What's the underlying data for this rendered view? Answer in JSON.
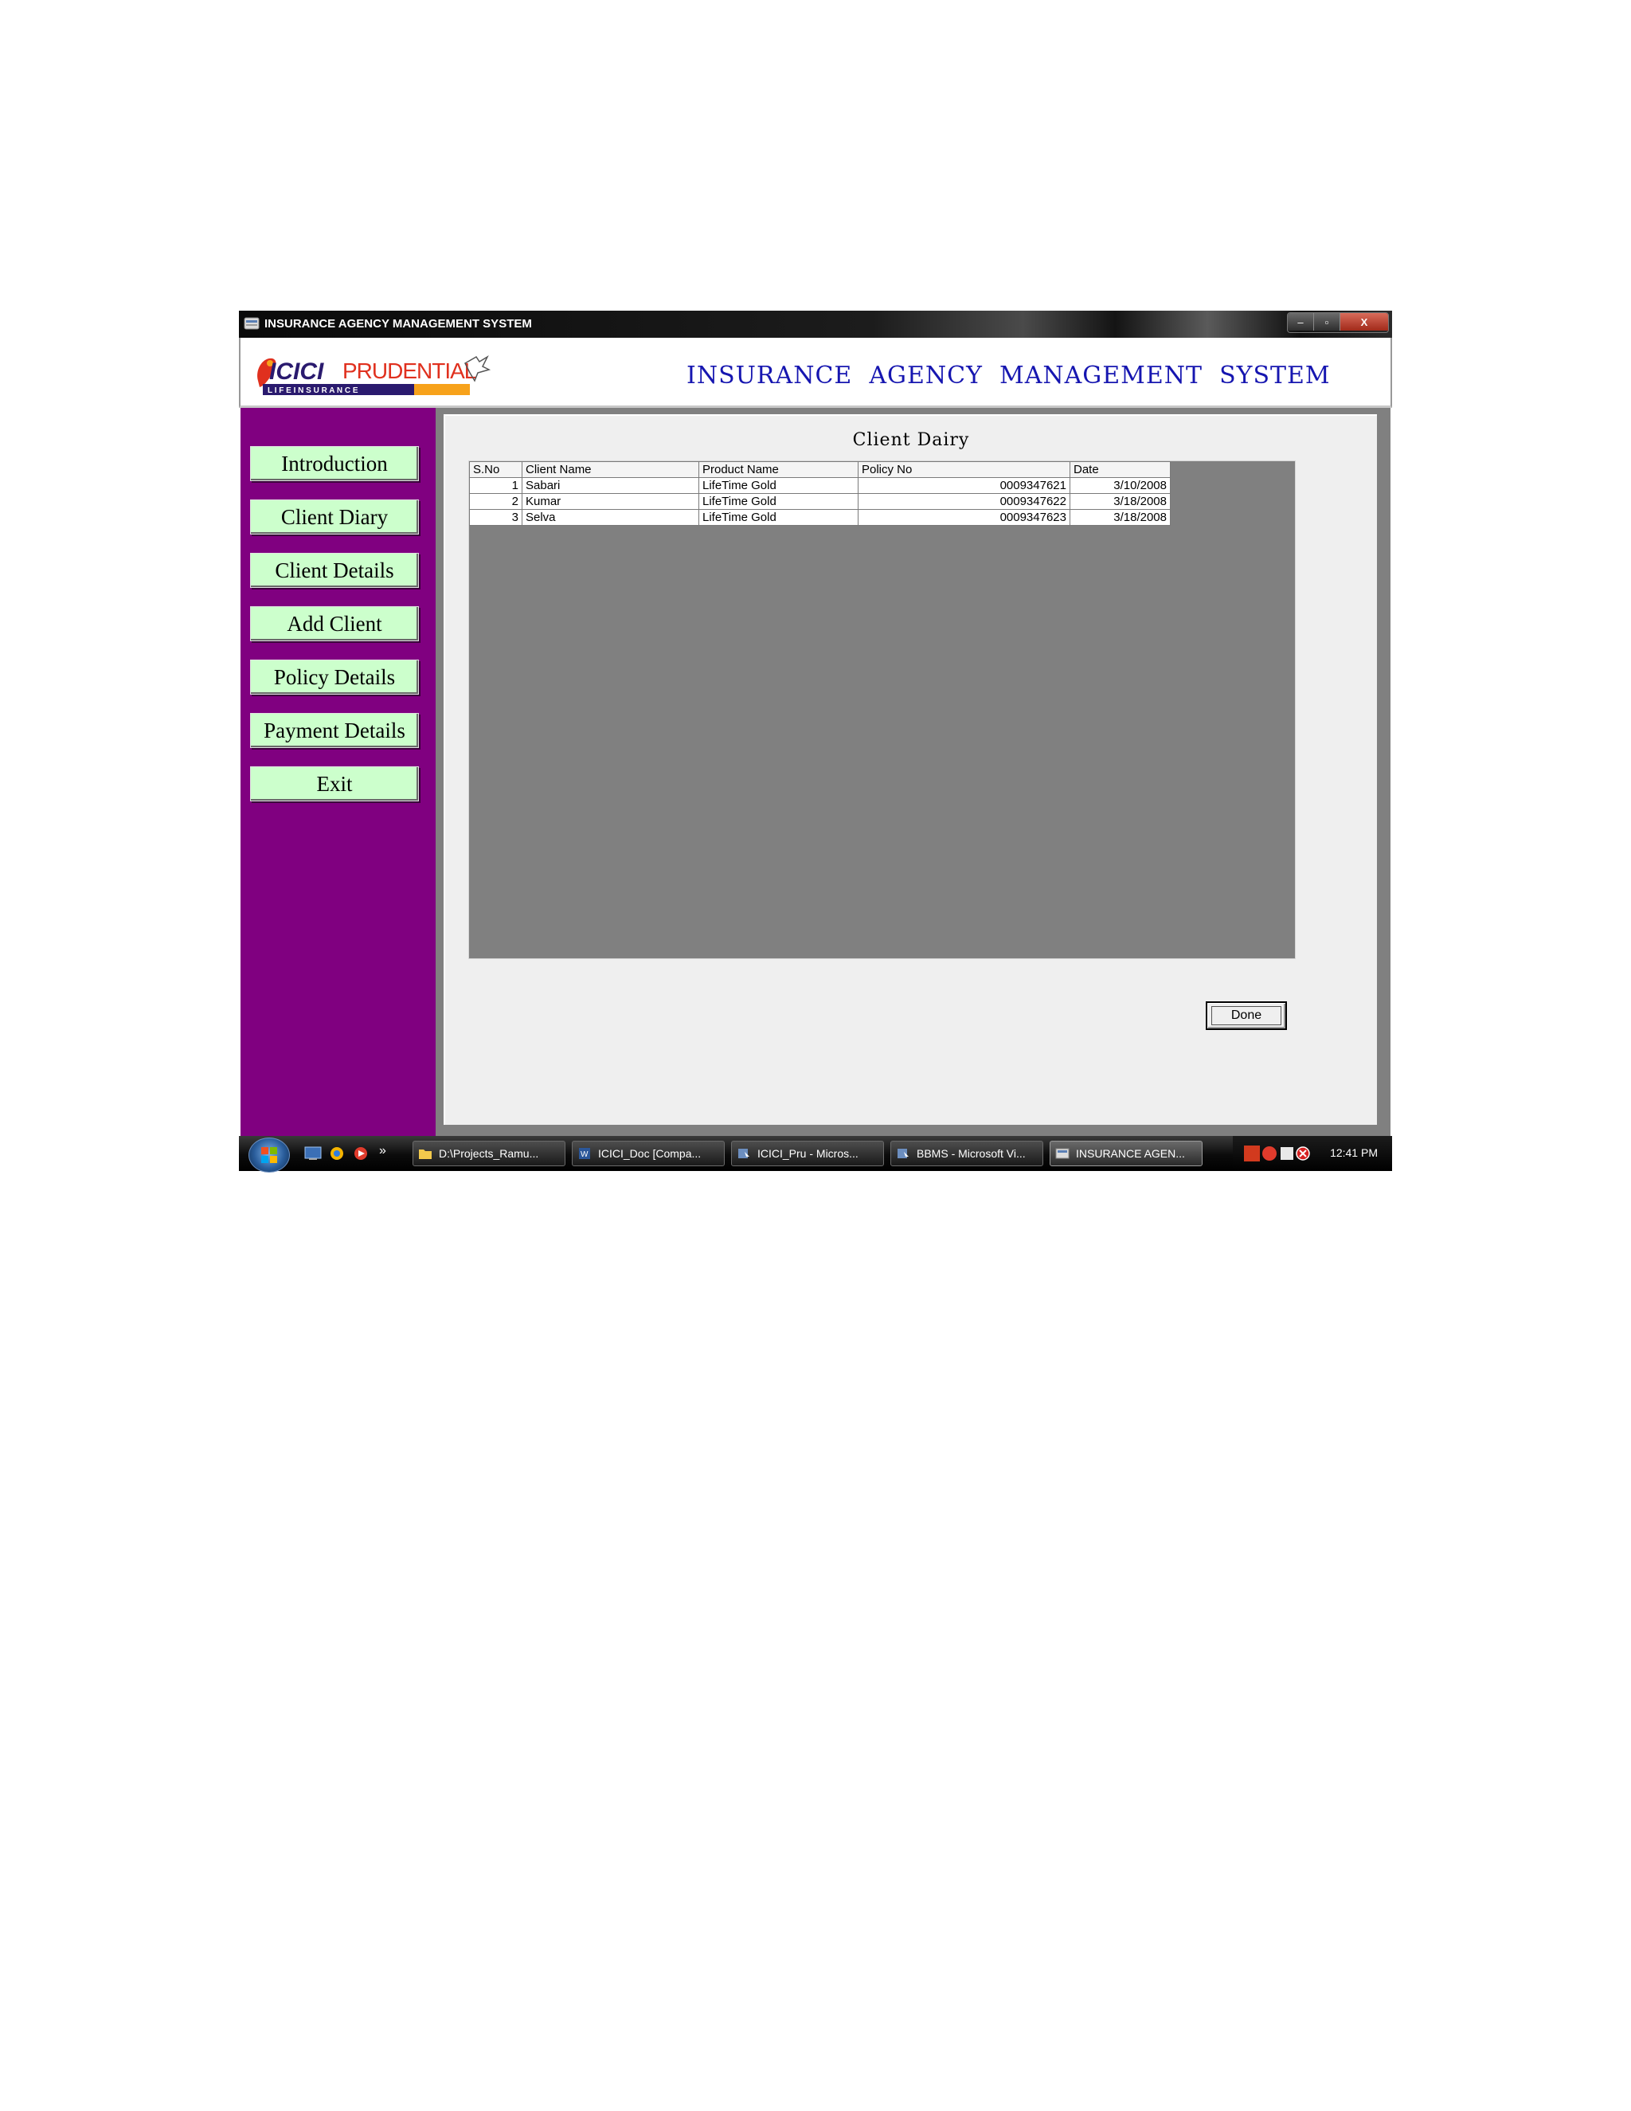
{
  "window": {
    "title": "INSURANCE AGENCY MANAGEMENT SYSTEM",
    "min_label": "–",
    "max_label": "▫",
    "close_label": "X"
  },
  "header": {
    "logo_text": "ICICI PRUDENTIAL",
    "logo_subtext": "L I F E   I N S U R A N C E",
    "app_title": "INSURANCE  AGENCY  MANAGEMENT  SYSTEM"
  },
  "sidebar": {
    "items": [
      {
        "label": "Introduction"
      },
      {
        "label": "Client Diary"
      },
      {
        "label": "Client Details"
      },
      {
        "label": "Add Client"
      },
      {
        "label": "Policy Details"
      },
      {
        "label": "Payment Details"
      },
      {
        "label": "Exit"
      }
    ]
  },
  "main": {
    "title": "Client Dairy",
    "table": {
      "headers": [
        "S.No",
        "Client Name",
        "Product Name",
        "Policy No",
        "Date"
      ],
      "rows": [
        [
          "1",
          "Sabari",
          "LifeTime Gold",
          "0009347621",
          "3/10/2008"
        ],
        [
          "2",
          "Kumar",
          "LifeTime Gold",
          "0009347622",
          "3/18/2008"
        ],
        [
          "3",
          "Selva",
          "LifeTime Gold",
          "0009347623",
          "3/18/2008"
        ]
      ]
    },
    "done_label": "Done"
  },
  "taskbar": {
    "quicklaunch_more": "»",
    "tasks": [
      {
        "label": "D:\\Projects_Ramu..."
      },
      {
        "label": "ICICI_Doc [Compa..."
      },
      {
        "label": "ICICI_Pru - Micros..."
      },
      {
        "label": "BBMS - Microsoft Vi..."
      },
      {
        "label": "INSURANCE AGEN..."
      }
    ],
    "clock": "12:41 PM"
  },
  "colors": {
    "sidebar": "#800080",
    "nav_button": "#ccffcc",
    "title_text": "#1616b0",
    "grid_bg": "#808080"
  }
}
